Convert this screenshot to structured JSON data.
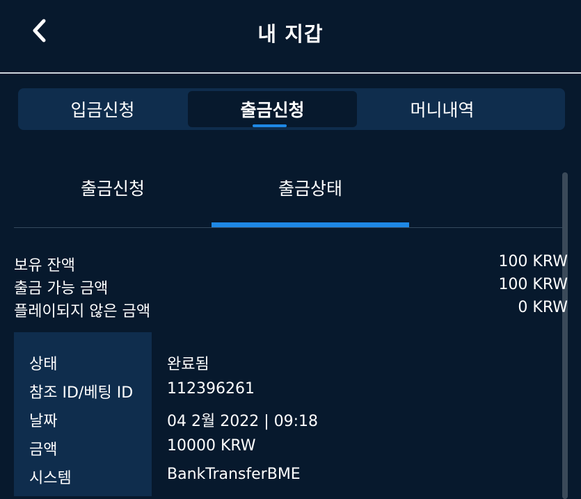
{
  "header": {
    "title": "내 지갑",
    "back_icon": "chevron-left-icon"
  },
  "main_tabs": [
    {
      "label": "입금신청",
      "active": false
    },
    {
      "label": "출금신청",
      "active": true
    },
    {
      "label": "머니내역",
      "active": false
    }
  ],
  "sub_tabs": [
    {
      "label": "출금신청",
      "active": false
    },
    {
      "label": "출금상태",
      "active": true
    }
  ],
  "balances": [
    {
      "label": "보유 잔액",
      "value": "100 KRW"
    },
    {
      "label": "출금 가능 금액",
      "value": "100 KRW"
    },
    {
      "label": "플레이되지 않은 금액",
      "value": "0 KRW"
    }
  ],
  "details": [
    {
      "label": "상태",
      "value": "완료됨"
    },
    {
      "label": "참조 ID/베팅 ID",
      "value": "112396261"
    },
    {
      "label": "날짜",
      "value": "04 2월 2022 | 09:18"
    },
    {
      "label": "금액",
      "value": "10000 KRW"
    },
    {
      "label": "시스템",
      "value": "BankTransferBME"
    }
  ],
  "colors": {
    "background": "#07192d",
    "panel": "#0f2d4d",
    "accent": "#1e88e5",
    "text": "#ffffff"
  }
}
